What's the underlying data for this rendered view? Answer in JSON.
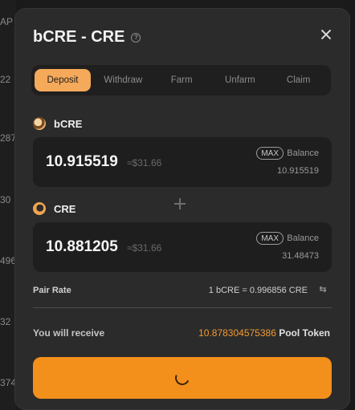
{
  "background": {
    "numbers": [
      "AP",
      "22",
      "287",
      "30",
      "496",
      "32",
      "374"
    ]
  },
  "modal": {
    "title": "bCRE - CRE",
    "help_icon": "question-circle-icon",
    "close_icon": "close-icon"
  },
  "tabs": [
    {
      "label": "Deposit",
      "active": true
    },
    {
      "label": "Withdraw",
      "active": false
    },
    {
      "label": "Farm",
      "active": false
    },
    {
      "label": "Unfarm",
      "active": false
    },
    {
      "label": "Claim",
      "active": false
    }
  ],
  "token_a": {
    "name": "bCRE",
    "amount": "10.915519",
    "usd": "≈$31.66",
    "max_label": "MAX",
    "balance_label": "Balance",
    "balance": "10.915519"
  },
  "token_b": {
    "name": "CRE",
    "amount": "10.881205",
    "usd": "≈$31.66",
    "max_label": "MAX",
    "balance_label": "Balance",
    "balance": "31.48473"
  },
  "pair_rate": {
    "label": "Pair Rate",
    "value": "1 bCRE = 0.996856 CRE"
  },
  "receive": {
    "label": "You will receive",
    "amount": "10.878304575386",
    "unit": "Pool Token"
  },
  "colors": {
    "accent": "#f38f1b",
    "tab_active": "#f5a95a",
    "modal_bg": "#2b2b2b"
  }
}
